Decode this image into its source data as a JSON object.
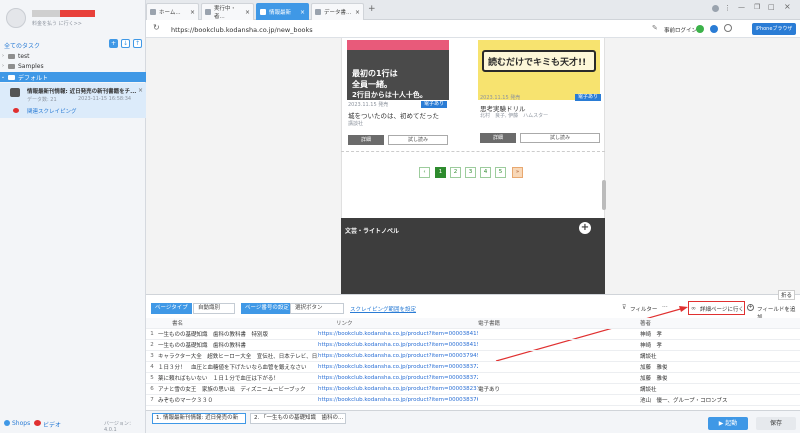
{
  "sidebar": {
    "promo": "料金を払う に行く>>",
    "all_tasks": "全てのタスク",
    "tree": [
      {
        "label": "test"
      },
      {
        "label": "Samples"
      }
    ],
    "default_folder": "デフォルト",
    "task": {
      "title": "情報最新刊情報: 近日発売の新刊書籍をチ...",
      "data_label": "データ数",
      "data_count": "21",
      "timestamp": "2023-11-15 16:58:34",
      "link": "関連スクレイピング"
    },
    "footer": {
      "shop": "Shops",
      "video": "ビデオ",
      "version": "バージョン：4.0.1"
    }
  },
  "tabs": [
    {
      "label": "ホーム...",
      "active": false
    },
    {
      "label": "実行中・者...",
      "active": false
    },
    {
      "label": "情報最新",
      "active": true
    },
    {
      "label": "データ書...",
      "active": false
    }
  ],
  "browser": {
    "url": "https://bookclub.kodansha.co.jp/new_books",
    "login_label": "事前ログイン",
    "device": "iPhoneブラウザ"
  },
  "books": [
    {
      "cover_text": [
        "最初の1行は",
        "全員一緒。",
        "2行目からは十人十色。"
      ],
      "date": "2023.11.15 発売",
      "badge": "電子あり",
      "title": "城をついたのは、初めてだった",
      "author": "講談社",
      "detail": "詳細",
      "preview": "試し読み"
    },
    {
      "cover_text": [
        "読むだけでキミも天才!!"
      ],
      "date": "2023.11.15 発売",
      "badge": "電子あり",
      "title": "思考実験ドリル",
      "author": "北村　良子, 伊藤　ハムスター",
      "detail": "詳細",
      "preview": "試し読み"
    }
  ],
  "pagination": [
    "1",
    "2",
    "3",
    "4",
    "5",
    "»"
  ],
  "section_title": "文芸・ライトノベル",
  "panel": {
    "page_type_label": "ページタイプ",
    "page_type_value": "自動識別",
    "pager_label": "ページ番号の設定",
    "pager_value": "選択ボタン",
    "range_link": "スクレイピング範囲を設定",
    "filter": "フィルター",
    "detail_link": "詳細ページに行く",
    "add_field": "フィールドを追加",
    "collapse": "折る",
    "columns": [
      "書名",
      "リンク",
      "電子書籍",
      "著者"
    ],
    "rows": [
      [
        "1",
        "一生ものの基礎知識　歯科の教科書　特別版",
        "https://bookclub.kodansha.co.jp/product?item=0000384196",
        "",
        "神崎　孝"
      ],
      [
        "2",
        "一生ものの基礎知識　歯科の教科書",
        "https://bookclub.kodansha.co.jp/product?item=0000384195",
        "",
        "神崎　孝"
      ],
      [
        "3",
        "キャラクター大全　超鉄ヒーロー大全　宣伝社、日本テレビ、日...",
        "https://bookclub.kodansha.co.jp/product?item=0000379499",
        "",
        "講談社"
      ],
      [
        "4",
        "１日３分！　血圧と血糖値を下げたいなら血管を鍛えなさい",
        "https://bookclub.kodansha.co.jp/product?item=0000383724",
        "",
        "加藤　雅俊"
      ],
      [
        "5",
        "薬に頼ればもいない　１日１分で血圧は下がる！",
        "https://bookclub.kodansha.co.jp/product?item=0000383723",
        "",
        "加藤　雅俊"
      ],
      [
        "6",
        "アナと雪の女王　家族の思い出　ディズニームービーブック",
        "https://bookclub.kodansha.co.jp/product?item=0000382375",
        "電子あり",
        "講談社"
      ],
      [
        "7",
        "みぞものマーク３３０",
        "https://bookclub.kodansha.co.jp/product?item=0000383766",
        "",
        "池山　優一、グループ・コロンブス"
      ]
    ],
    "bottom_tabs": [
      "1. 情報最新刊情報: 近日発売の新",
      "2. 「一生ものの基礎知識　歯科の..."
    ],
    "start": "起動",
    "save": "保存"
  }
}
